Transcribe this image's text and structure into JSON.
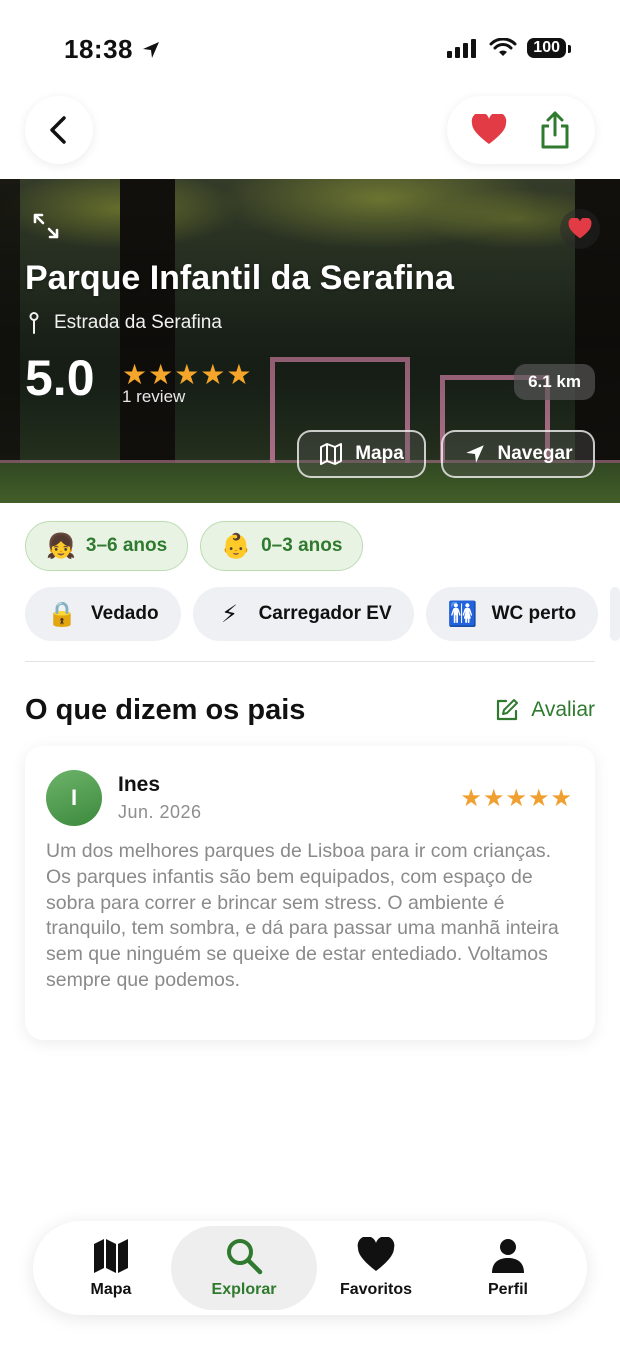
{
  "status_bar": {
    "time": "18:38",
    "battery": "100"
  },
  "hero": {
    "title": "Parque Infantil da Serafina",
    "address": "Estrada da Serafina",
    "rating": "5.0",
    "stars": "★★★★★",
    "reviews_count": "1 review",
    "distance": "6.1 km",
    "map_button": "Mapa",
    "navigate_button": "Navegar"
  },
  "age_chips": [
    {
      "emoji": "👧",
      "label": "3–6 anos"
    },
    {
      "emoji": "👶",
      "label": "0–3 anos"
    }
  ],
  "features": [
    {
      "emoji": "🔒",
      "label": "Vedado"
    },
    {
      "emoji": "⚡",
      "label": "Carregador EV"
    },
    {
      "emoji": "🚻",
      "label": "WC perto"
    }
  ],
  "reviews_section": {
    "title": "O que dizem os pais",
    "rate_action": "Avaliar",
    "items": [
      {
        "initial": "I",
        "name": "Ines",
        "date": "Jun. 2026",
        "stars": "★★★★★",
        "text": "Um dos melhores parques de Lisboa para ir com crianças. Os parques infantis são bem equipados, com espaço de sobra para correr e brincar sem stress. O ambiente é tranquilo, tem sombra, e dá para passar uma manhã inteira sem que ninguém se queixe de estar entediado. Voltamos sempre que podemos."
      }
    ]
  },
  "tab_bar": {
    "tabs": [
      {
        "label": "Mapa",
        "icon": "map-icon"
      },
      {
        "label": "Explorar",
        "icon": "search-icon",
        "active": true
      },
      {
        "label": "Favoritos",
        "icon": "heart-icon"
      },
      {
        "label": "Perfil",
        "icon": "person-icon"
      }
    ]
  },
  "colors": {
    "accent_green": "#2f7a2f",
    "favorite_red": "#e23b45",
    "star_orange": "#f0a030"
  }
}
